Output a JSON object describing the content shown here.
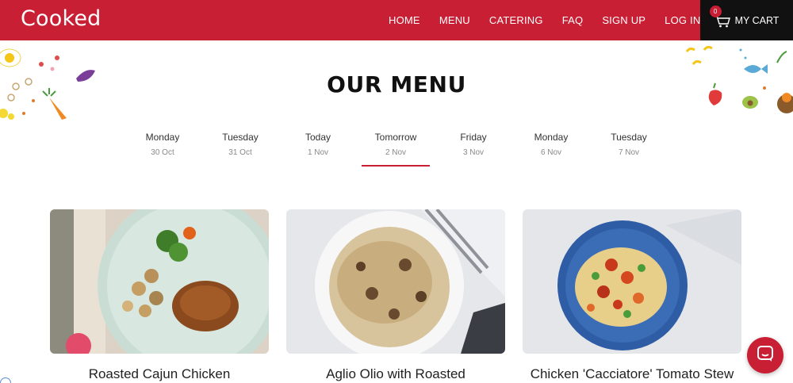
{
  "header": {
    "logo": "Cooked",
    "nav": [
      "HOME",
      "MENU",
      "CATERING",
      "FAQ",
      "SIGN UP",
      "LOG IN"
    ],
    "cart_label": "MY CART",
    "cart_count": "0"
  },
  "page_title": "OUR MENU",
  "days": [
    {
      "name": "Monday",
      "date": "30 Oct"
    },
    {
      "name": "Tuesday",
      "date": "31 Oct"
    },
    {
      "name": "Today",
      "date": "1 Nov"
    },
    {
      "name": "Tomorrow",
      "date": "2 Nov"
    },
    {
      "name": "Friday",
      "date": "3 Nov"
    },
    {
      "name": "Monday",
      "date": "6 Nov"
    },
    {
      "name": "Tuesday",
      "date": "7 Nov"
    }
  ],
  "active_day": "Tomorrow",
  "dishes": [
    {
      "name": "Roasted Cajun Chicken"
    },
    {
      "name": "Aglio Olio with Roasted"
    },
    {
      "name": "Chicken 'Cacciatore' Tomato Stew"
    }
  ],
  "colors": {
    "brand": "#c81f35",
    "cart_bg": "#111111"
  },
  "icons": {
    "cart": "cart-icon",
    "chat": "chat-icon"
  }
}
